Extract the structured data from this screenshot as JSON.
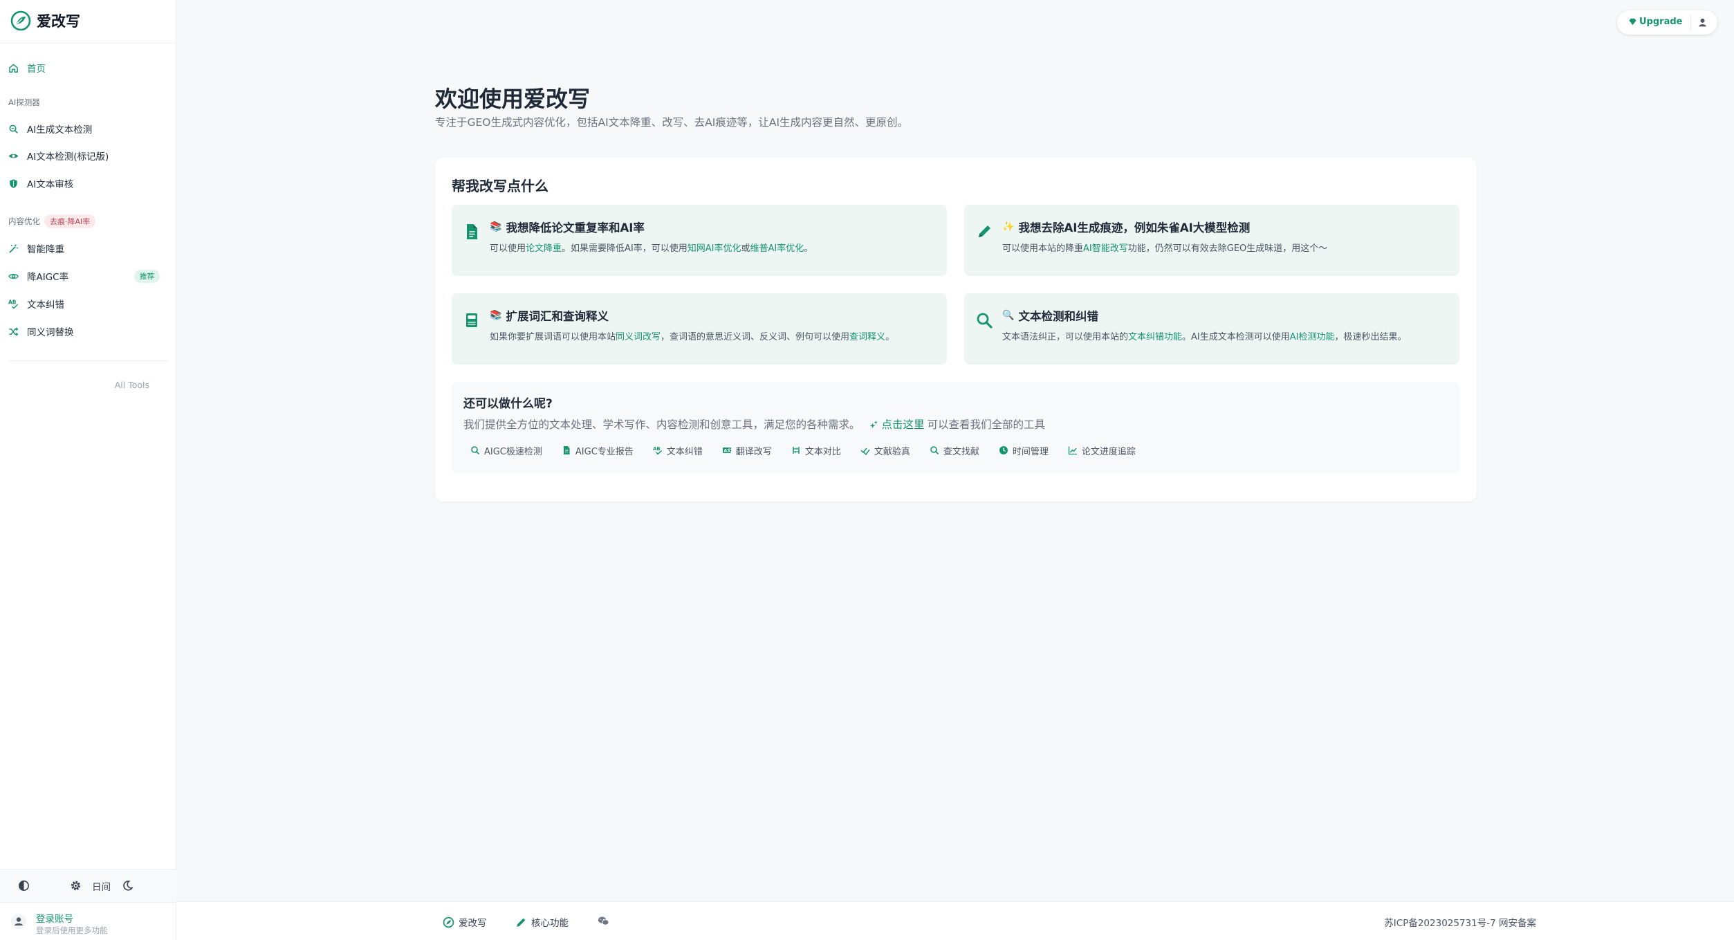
{
  "app": {
    "name": "爱改写"
  },
  "sidebar": {
    "home": "首页",
    "section_ai": "AI探测器",
    "ai_items": [
      "AI生成文本检测",
      "AI文本检测(标记版)",
      "AI文本审核"
    ],
    "section_content": "内容优化",
    "section_content_badge": "去痕·降AI率",
    "content_items": [
      "智能降重",
      "降AIGC率",
      "文本纠错",
      "同义词替换"
    ],
    "recommend_badge": "推荐",
    "all_tools": "All Tools",
    "theme_label": "日间",
    "login_title": "登录账号",
    "login_sub": "登录后使用更多功能"
  },
  "topbar": {
    "upgrade": "Upgrade"
  },
  "welcome": {
    "title": "欢迎使用爱改写",
    "subtitle": "专注于GEO生成式内容优化，包括AI文本降重、改写、去AI痕迹等，让AI生成内容更自然、更原创。"
  },
  "panel": {
    "title": "帮我改写点什么",
    "cards": [
      {
        "emoji": "📚",
        "title": "我想降低论文重复率和AI率",
        "desc_parts": [
          [
            "可以使用",
            false
          ],
          [
            "论文降重",
            true
          ],
          [
            "。如果需要降低AI率，可以使用",
            false
          ],
          [
            "知网AI率优化",
            true
          ],
          [
            "或",
            false
          ],
          [
            "维普AI率优化",
            true
          ],
          [
            "。",
            false
          ]
        ]
      },
      {
        "emoji": "✨",
        "title": "我想去除AI生成痕迹，例如朱雀AI大模型检测",
        "desc_parts": [
          [
            "可以使用本站的降重",
            false
          ],
          [
            "AI智能改写",
            true
          ],
          [
            "功能，仍然可以有效去除GEO生成味道，用这个～",
            false
          ]
        ]
      },
      {
        "emoji": "📚",
        "title": "扩展词汇和查询释义",
        "desc_parts": [
          [
            "如果你要扩展词语可以使用本站",
            false
          ],
          [
            "同义词改写",
            true
          ],
          [
            "，查词语的意思近义词、反义词、例句可以使用",
            false
          ],
          [
            "查词释义",
            true
          ],
          [
            "。",
            false
          ]
        ]
      },
      {
        "emoji": "🔍",
        "title": "文本检测和纠错",
        "desc_parts": [
          [
            "文本语法纠正，可以使用本站的",
            false
          ],
          [
            "文本纠错功能",
            true
          ],
          [
            "。AI生成文本检测可以使用",
            false
          ],
          [
            "AI检测功能",
            true
          ],
          [
            "，极速秒出结果。",
            false
          ]
        ]
      }
    ],
    "more": {
      "title": "还可以做什么呢?",
      "text": "我们提供全方位的文本处理、学术写作、内容检测和创意工具，满足您的各种需求。",
      "link": "点击这里",
      "link_suffix": "可以查看我们全部的工具",
      "chips": [
        "AIGC极速检测",
        "AIGC专业报告",
        "文本纠错",
        "翻译改写",
        "文本对比",
        "文献验真",
        "查文找献",
        "时间管理",
        "论文进度追踪"
      ]
    }
  },
  "footer": {
    "brand": "爱改写",
    "core": "核心功能",
    "icp": "苏ICP备2023025731号-7 网安备案"
  }
}
